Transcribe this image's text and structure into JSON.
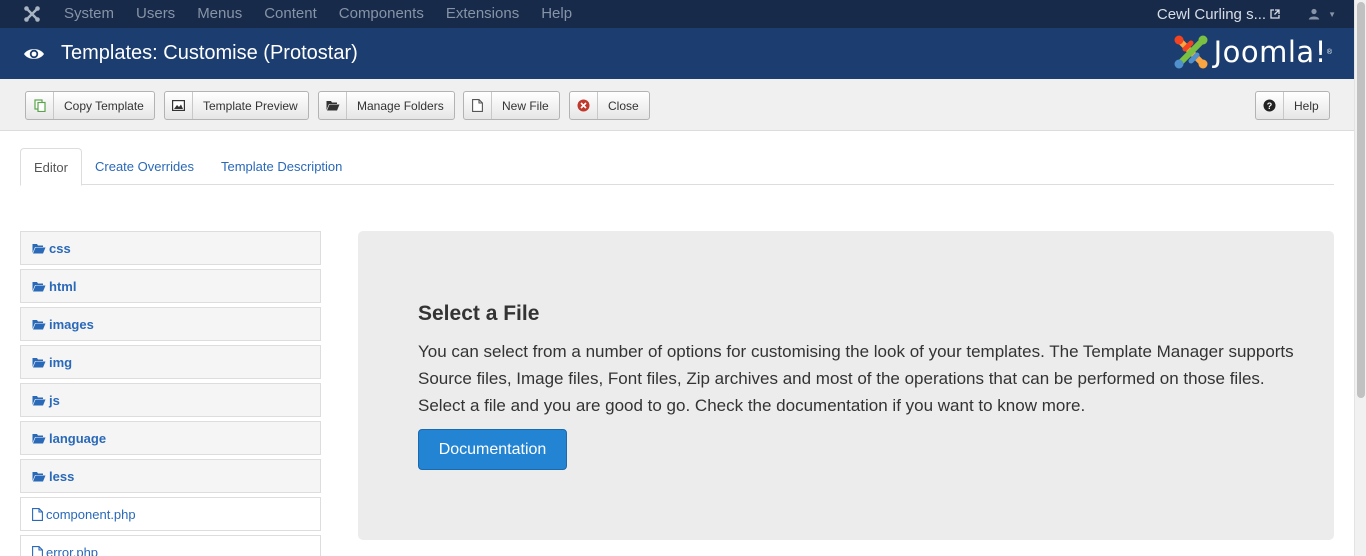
{
  "navbar": {
    "logo_icon": "joomla-icon",
    "menu": [
      "System",
      "Users",
      "Menus",
      "Content",
      "Components",
      "Extensions",
      "Help"
    ],
    "site_name": "Cewl Curling s...",
    "user_icon": "user-icon"
  },
  "header": {
    "title": "Templates: Customise (Protostar)",
    "brand": "Joomla!",
    "brand_mark": "®"
  },
  "toolbar": {
    "copy_template": "Copy Template",
    "template_preview": "Template Preview",
    "manage_folders": "Manage Folders",
    "new_file": "New File",
    "close": "Close",
    "help": "Help"
  },
  "tabs": {
    "editor": "Editor",
    "create_overrides": "Create Overrides",
    "template_description": "Template Description",
    "active": "Editor"
  },
  "tree": {
    "folders": [
      "css",
      "html",
      "images",
      "img",
      "js",
      "language",
      "less"
    ],
    "files": [
      "component.php",
      "error.php"
    ]
  },
  "main": {
    "heading": "Select a File",
    "description": "You can select from a number of options for customising the look of your templates. The Template Manager supports Source files, Image files, Font files, Zip archives and most of the operations that can be performed on those files. Select a file and you are good to go. Check the documentation if you want to know more.",
    "doc_button": "Documentation"
  },
  "colors": {
    "navbar": "#172a4a",
    "header": "#1c3d6f",
    "link": "#2a69b8",
    "primary_button": "#2384d3",
    "close_icon": "#c0392b"
  }
}
